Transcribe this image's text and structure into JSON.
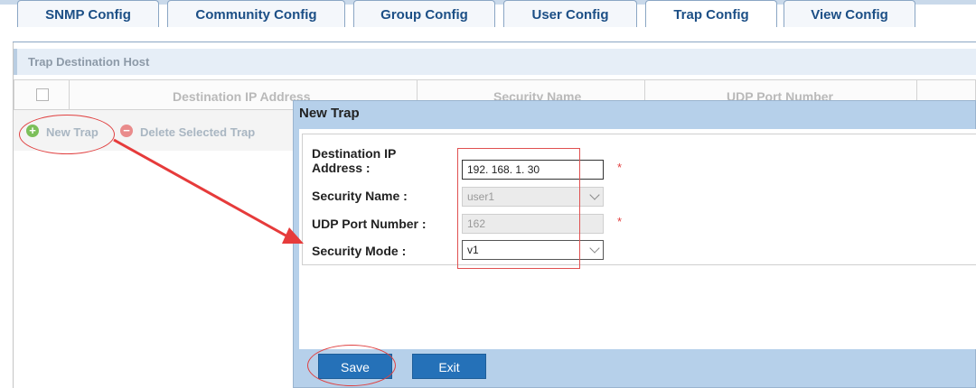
{
  "tabs": [
    {
      "label": "SNMP Config"
    },
    {
      "label": "Community Config"
    },
    {
      "label": "Group Config"
    },
    {
      "label": "User Config"
    },
    {
      "label": "Trap Config"
    },
    {
      "label": "View Config"
    }
  ],
  "active_tab": "Trap Config",
  "section_title": "Trap Destination Host",
  "table": {
    "columns": [
      "Destination IP Address",
      "Security Name",
      "UDP Port Number"
    ]
  },
  "toolbar": {
    "new_trap": "New Trap",
    "delete_selected": "Delete Selected Trap"
  },
  "dialog": {
    "title": "New Trap",
    "fields": {
      "dest_ip_label_1": "Destination IP",
      "dest_ip_label_2": "Address :",
      "dest_ip_value": "192. 168. 1. 30",
      "security_name_label": "Security Name :",
      "security_name_value": "user1",
      "udp_port_label": "UDP Port Number :",
      "udp_port_value": "162",
      "security_mode_label": "Security Mode :",
      "security_mode_value": "v1",
      "required_mark": "*"
    },
    "buttons": {
      "save": "Save",
      "exit": "Exit"
    }
  },
  "colors": {
    "accent": "#2571b8",
    "annotation": "#e04040",
    "dialog_bg": "#b6d0ea"
  }
}
